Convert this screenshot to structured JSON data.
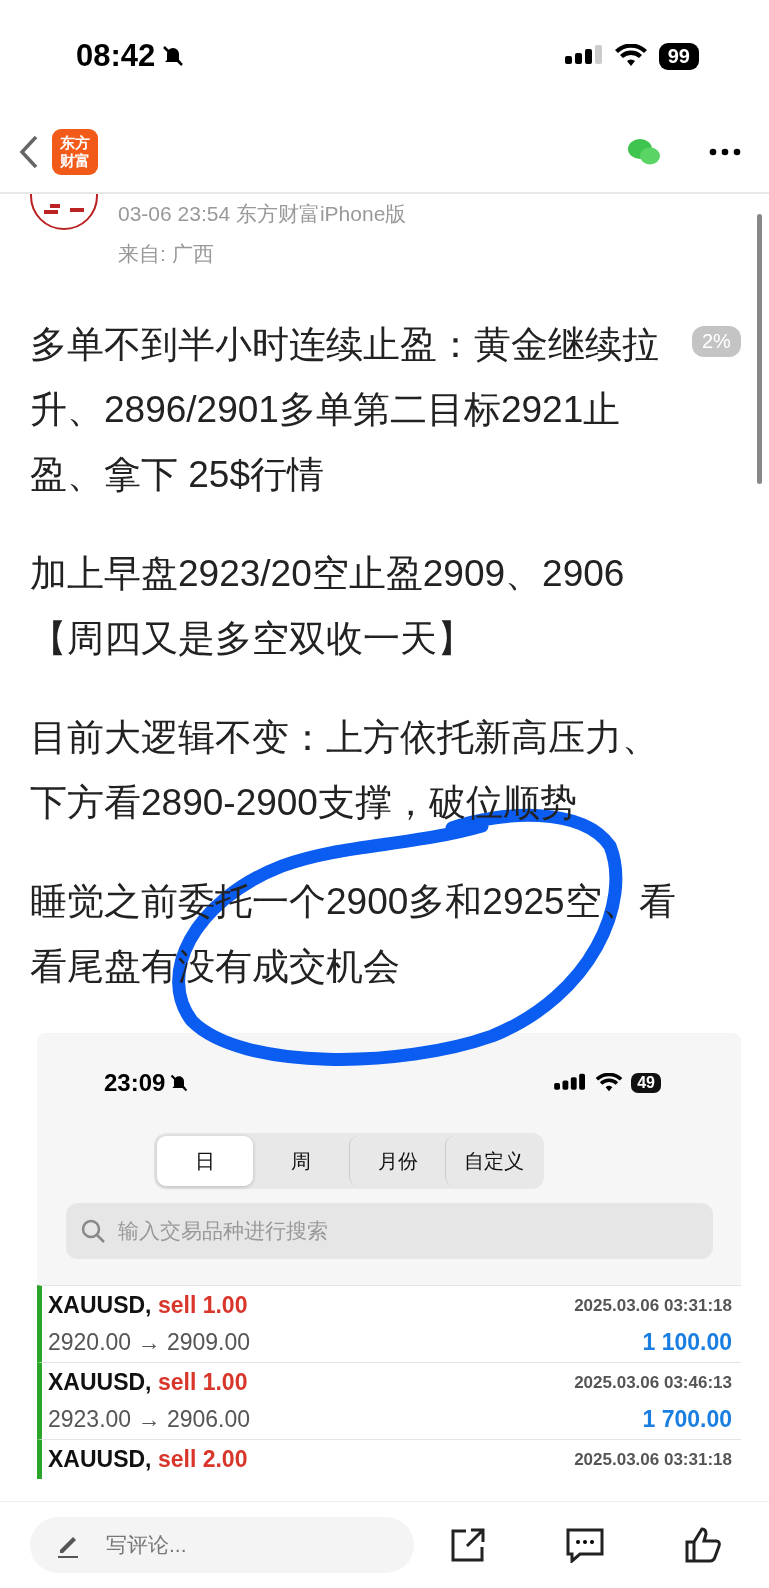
{
  "status_bar": {
    "time": "08:42",
    "battery": "99"
  },
  "nav": {
    "logo_lines": [
      "东方",
      "财富"
    ]
  },
  "post": {
    "meta": "03-06 23:54 东方财富iPhone版",
    "location": "来自: 广西",
    "paragraphs": [
      "多单不到半小时连续止盈：黄金继续拉升、2896/2901多单第二目标2921止盈、拿下 25$行情",
      "加上早盘2923/20空止盈2909、2906【周四又是多空双收一天】",
      "目前大逻辑不变：上方依托新高压力、下方看2890-2900支撑，破位顺势",
      "睡觉之前委托一个2900多和2925空、看看尾盘有没有成交机会"
    ]
  },
  "read_badge": "2%",
  "embedded_screenshot": {
    "status_bar": {
      "time": "23:09",
      "battery": "49"
    },
    "tabs": [
      {
        "label": "日",
        "selected": true
      },
      {
        "label": "周",
        "selected": false
      },
      {
        "label": "月份",
        "selected": false
      },
      {
        "label": "自定义",
        "selected": false
      }
    ],
    "search": {
      "placeholder": "输入交易品种进行搜索"
    },
    "trades": [
      {
        "symbol": "XAUUSD,",
        "side": "sell 1.00",
        "time": "2025.03.06 03:31:18",
        "prices": "2920.00 → 2909.00",
        "profit": "1 100.00"
      },
      {
        "symbol": "XAUUSD,",
        "side": "sell 1.00",
        "time": "2025.03.06 03:46:13",
        "prices": "2923.00 → 2906.00",
        "profit": "1 700.00"
      },
      {
        "symbol": "XAUUSD,",
        "side": "sell 2.00",
        "time": "2025.03.06 03:31:18"
      }
    ]
  },
  "bottom_bar": {
    "comment": {
      "placeholder": "写评论..."
    }
  }
}
